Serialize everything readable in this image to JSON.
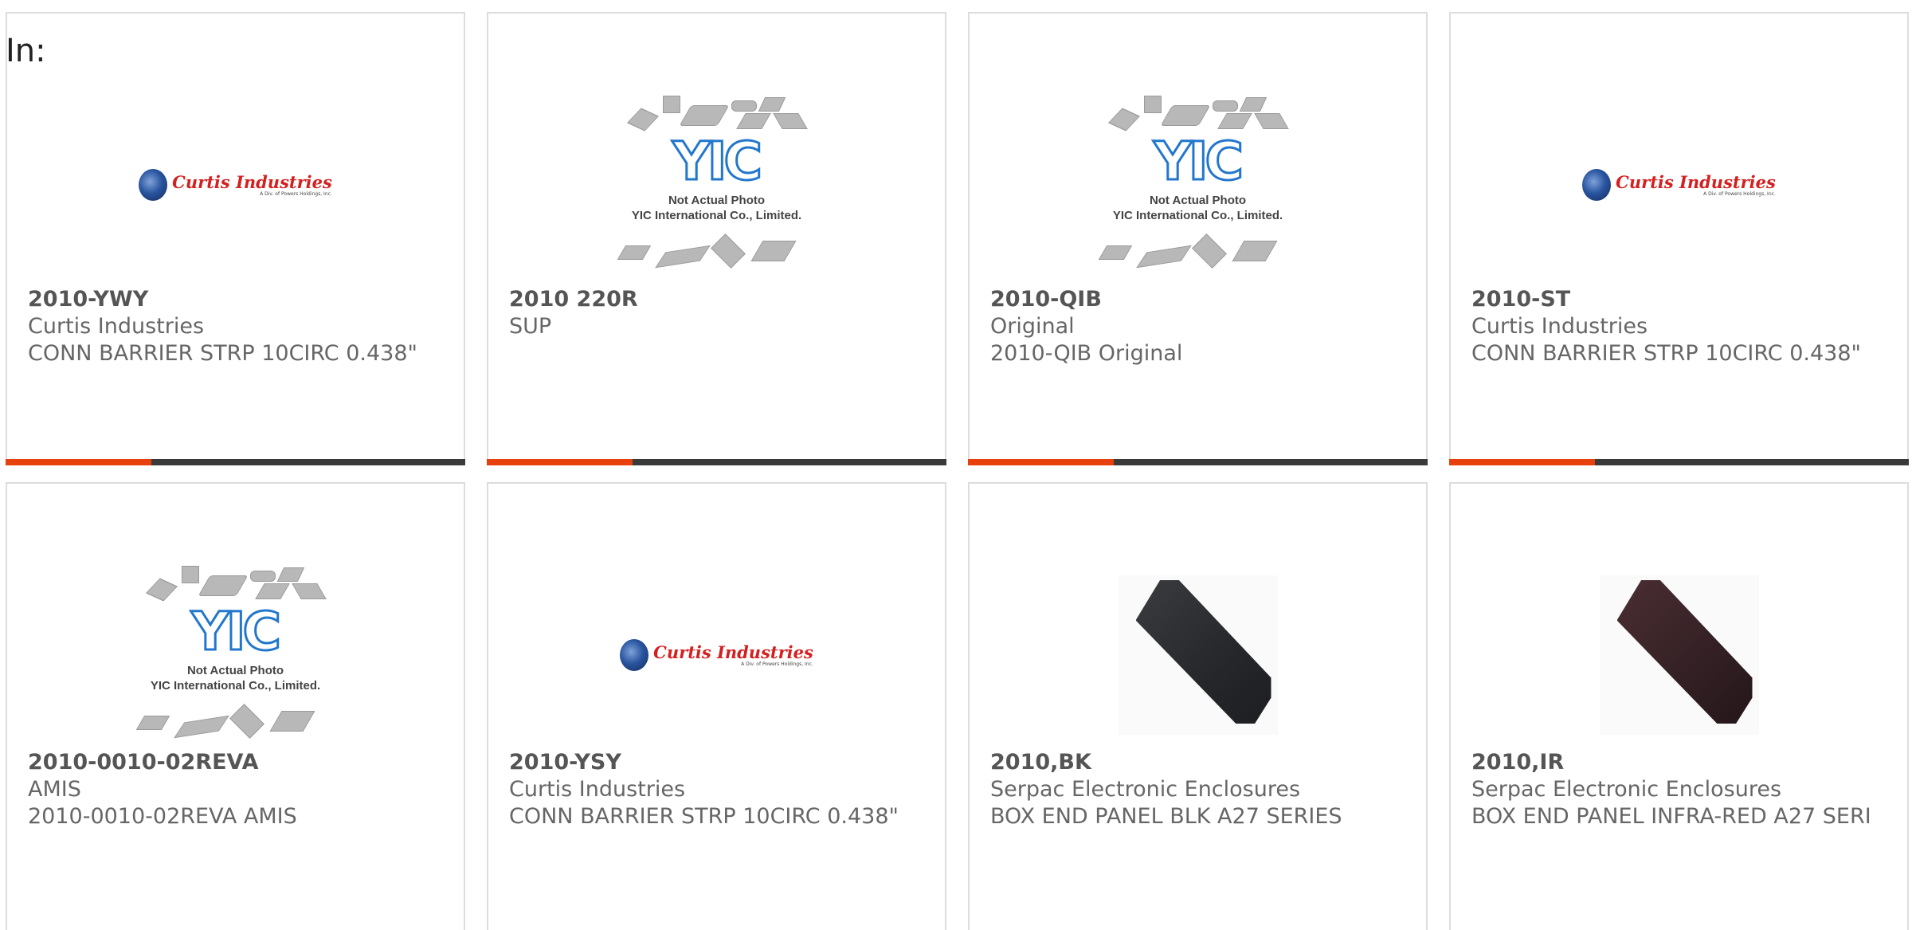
{
  "filter": {
    "label": "In:"
  },
  "products": [
    {
      "part": "2010-YWY",
      "manufacturer": "Curtis Industries",
      "description": "CONN BARRIER STRP 10CIRC 0.438\"",
      "image": "curtis-logo"
    },
    {
      "part": "2010 220R",
      "manufacturer": "SUP",
      "description": "",
      "image": "yic-placeholder"
    },
    {
      "part": "2010-QIB",
      "manufacturer": "Original",
      "description": "2010-QIB Original",
      "image": "yic-placeholder"
    },
    {
      "part": "2010-ST",
      "manufacturer": "Curtis Industries",
      "description": "CONN BARRIER STRP 10CIRC 0.438\"",
      "image": "curtis-logo"
    },
    {
      "part": "2010-0010-02REVA",
      "manufacturer": "AMIS",
      "description": "2010-0010-02REVA AMIS",
      "image": "yic-placeholder"
    },
    {
      "part": "2010-YSY",
      "manufacturer": "Curtis Industries",
      "description": "CONN BARRIER STRP 10CIRC 0.438\"",
      "image": "curtis-logo"
    },
    {
      "part": "2010,BK",
      "manufacturer": "Serpac Electronic Enclosures",
      "description": "BOX END PANEL BLK A27 SERIES",
      "image": "end-panel-black",
      "color": "#2f3135"
    },
    {
      "part": "2010,IR",
      "manufacturer": "Serpac Electronic Enclosures",
      "description": "BOX END PANEL INFRA-RED A27 SERI",
      "image": "end-panel-infrared",
      "color": "#3a2428"
    }
  ],
  "logos": {
    "curtis": {
      "name": "Curtis Industries",
      "tagline": "A Div. of Powers Holdings, Inc."
    },
    "yic": {
      "mark": "YIC",
      "line1": "Not Actual Photo",
      "line2": "YIC International Co., Limited."
    }
  },
  "colors": {
    "accent": "#e8400c",
    "bar": "#3a3a3a",
    "border": "#dddddd"
  }
}
